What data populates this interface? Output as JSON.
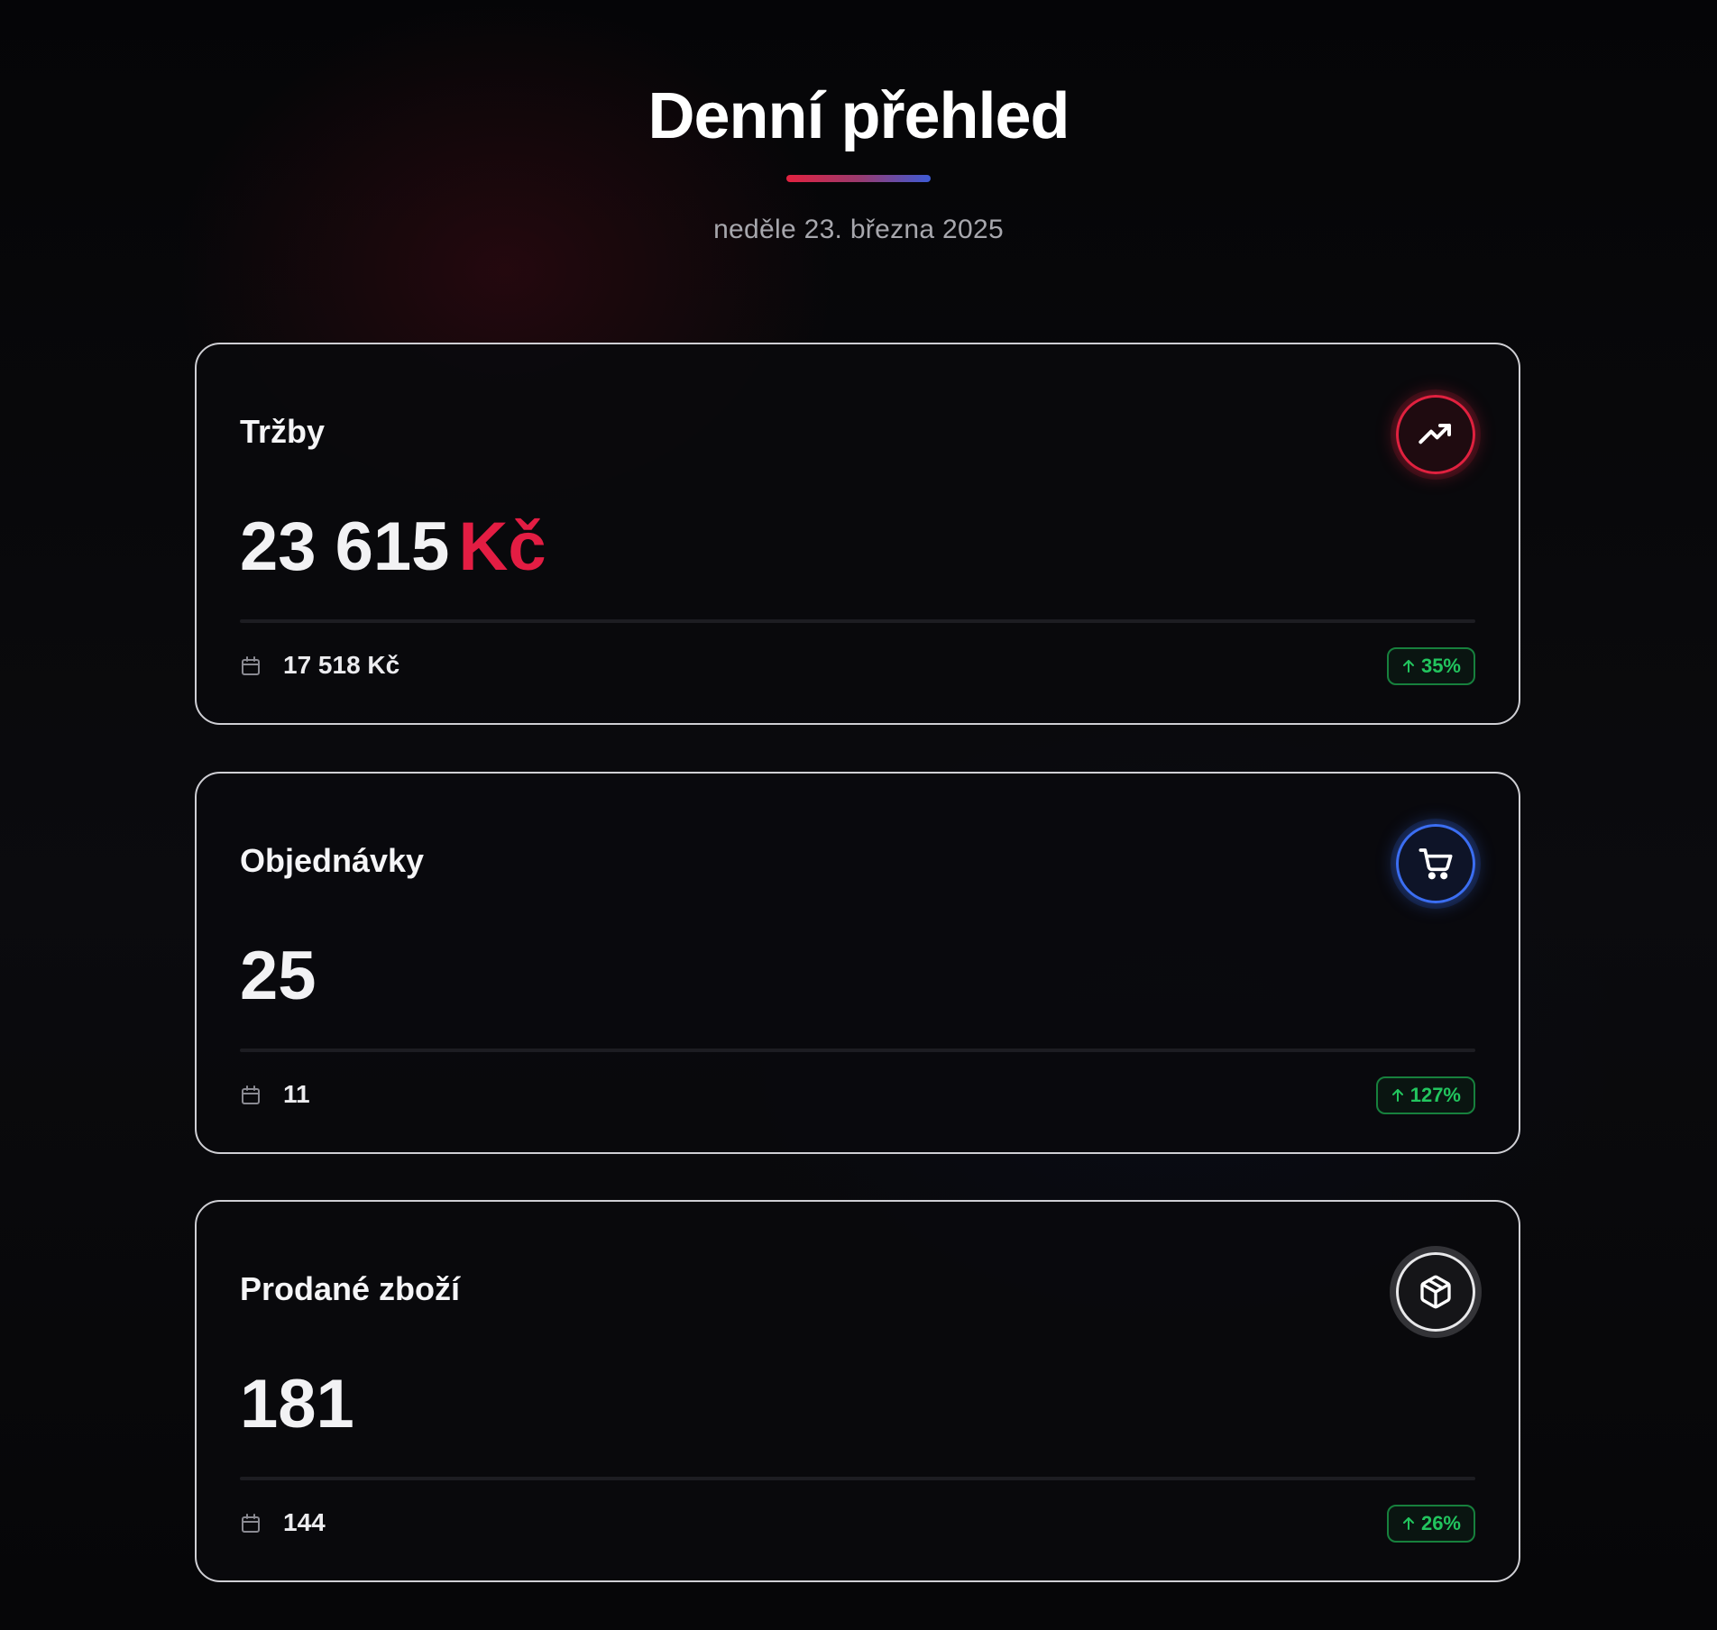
{
  "header": {
    "title": "Denní přehled",
    "date": "neděle 23. března 2025"
  },
  "accent": {
    "red": "#e31d43",
    "blue": "#3b6ef2",
    "green": "#22c55e",
    "gradient": [
      "#e3213f",
      "#3d5bd6"
    ]
  },
  "cards": [
    {
      "label": "Tržby",
      "icon": "trending-up-icon",
      "value": "23 615",
      "unit": "Kč",
      "previous": "17 518 Kč",
      "change": "35%",
      "change_direction": "up"
    },
    {
      "label": "Objednávky",
      "icon": "shopping-cart-icon",
      "value": "25",
      "previous": "11",
      "change": "127%",
      "change_direction": "up"
    },
    {
      "label": "Prodané zboží",
      "icon": "package-icon",
      "value": "181",
      "previous": "144",
      "change": "26%",
      "change_direction": "up"
    }
  ]
}
